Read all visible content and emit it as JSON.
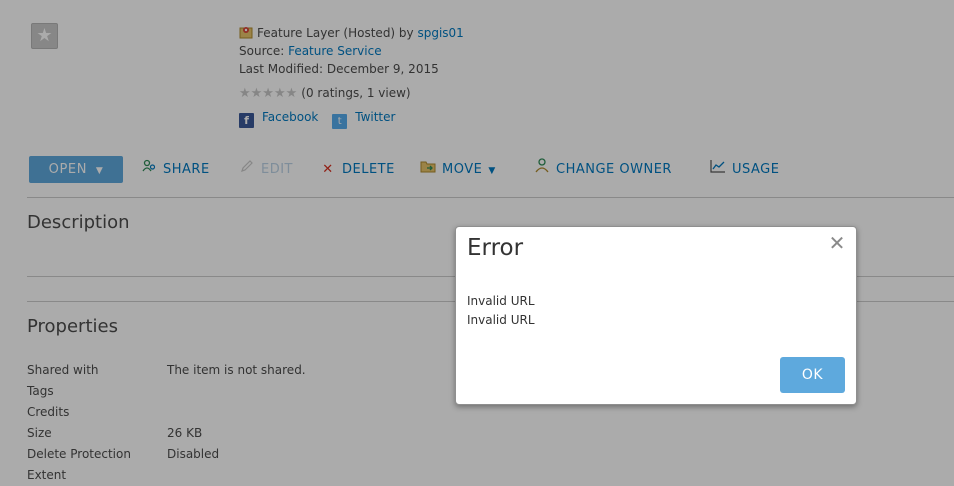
{
  "item": {
    "thumbnail_icon": "star-icon",
    "type_text": "Feature Layer (Hosted) by ",
    "owner": "spgis01",
    "source_label": "Source: ",
    "source_value": "Feature Service",
    "last_modified": "Last Modified: December 9, 2015",
    "ratings": "(0 ratings, 1 view)",
    "facebook": "Facebook",
    "twitter": "Twitter"
  },
  "toolbar": {
    "open": "OPEN",
    "share": "SHARE",
    "edit": "EDIT",
    "delete": "DELETE",
    "move": "MOVE",
    "change_owner": "CHANGE OWNER",
    "usage": "USAGE"
  },
  "sections": {
    "description": "Description",
    "properties": "Properties"
  },
  "properties": [
    {
      "key": "Shared with",
      "value": "The item is not shared."
    },
    {
      "key": "Tags",
      "value": ""
    },
    {
      "key": "Credits",
      "value": ""
    },
    {
      "key": "Size",
      "value": "26 KB"
    },
    {
      "key": "Delete Protection",
      "value": "Disabled"
    },
    {
      "key": "Extent",
      "value": ""
    }
  ],
  "dialog": {
    "title": "Error",
    "line1": "Invalid URL",
    "line2": "Invalid URL",
    "ok": "OK",
    "close_icon": "close-icon"
  },
  "colors": {
    "accent": "#0079c1",
    "button": "#5ea9dd"
  }
}
